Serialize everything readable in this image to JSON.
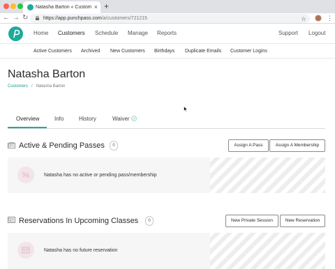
{
  "browser": {
    "tab_title": "Natasha Barton « Customers «",
    "tab_close": "×",
    "new_tab": "+",
    "back": "←",
    "forward": "→",
    "reload": "↻",
    "url_host": "https://app.punchpass.com",
    "url_path": "/a/customers/721215",
    "star": "☆",
    "menu": "⋮"
  },
  "header": {
    "nav": [
      "Home",
      "Customers",
      "Schedule",
      "Manage",
      "Reports"
    ],
    "support": "Support",
    "logout": "Logout"
  },
  "subnav": [
    "Active Customers",
    "Archived",
    "New Customers",
    "Birthdays",
    "Duplicate Emails",
    "Customer Logins"
  ],
  "page": {
    "title": "Natasha Barton",
    "breadcrumb": {
      "parent": "Customers",
      "separator": "/",
      "current": "Natasha Barton"
    }
  },
  "tabs": [
    "Overview",
    "Info",
    "History",
    "Waiver"
  ],
  "sections": {
    "passes": {
      "title": "Active & Pending Passes",
      "count": "0",
      "buttons": [
        "Assign A Pass",
        "Assign A Membership"
      ],
      "empty_text": "Natasha has no active or pending pass/membership"
    },
    "reservations": {
      "title": "Reservations In Upcoming Classes",
      "count": "0",
      "buttons": [
        "New Private Session",
        "New Reservation"
      ],
      "empty_text": "Natasha has no future reservation"
    }
  },
  "colors": {
    "brand": "#1cab9b",
    "empty_icon_bg": "#f2e4e8"
  }
}
